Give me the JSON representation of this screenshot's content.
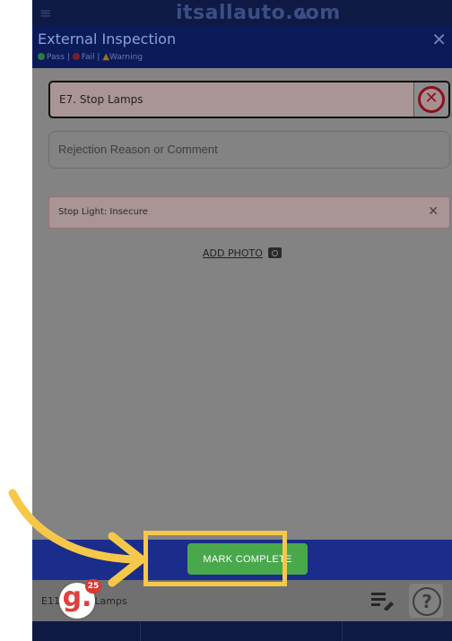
{
  "topbar": {
    "menu_icon": "menu-arrow-icon",
    "site_title": "itsallauto.com",
    "home_icon": "home-icon"
  },
  "header": {
    "title": "External Inspection",
    "legend": {
      "pass": "Pass |",
      "fail": "Fail |",
      "warning": "Warning"
    },
    "close_icon": "close-icon"
  },
  "inspection": {
    "item_label": "E7. Stop Lamps",
    "status": "fail",
    "comment_placeholder": "Rejection Reason or Comment",
    "comment_value": "",
    "reasons": [
      {
        "label": "Stop Light: Insecure"
      }
    ],
    "add_photo_label": "ADD PHOTO"
  },
  "actions": {
    "mark_complete": "MARK COMPLETE"
  },
  "bottom": {
    "next_item_prefix": "E11",
    "next_item_suffix": "Lamps"
  },
  "overlay": {
    "badge_count": "25",
    "logo_letter": "g."
  },
  "colors": {
    "highlight": "#f6c84a",
    "mark_complete": "#49a84b",
    "fail": "#8a1020",
    "header": "#0b1a58"
  }
}
